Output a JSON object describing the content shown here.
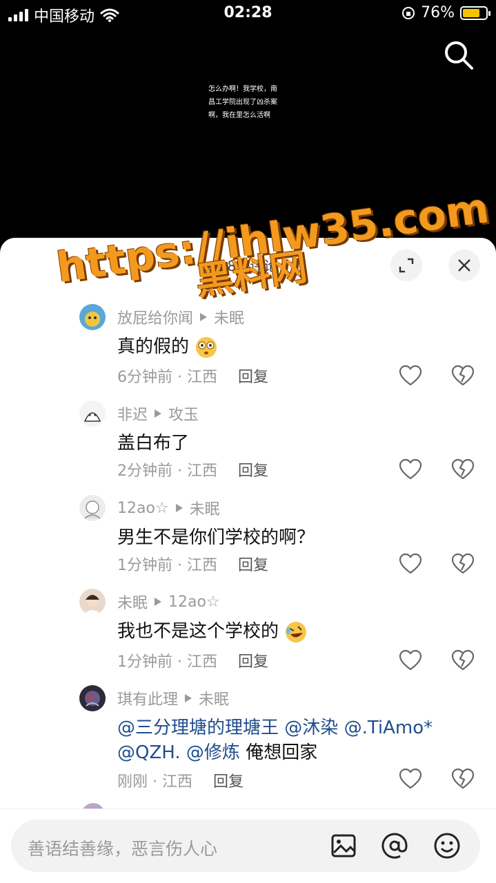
{
  "status_bar": {
    "carrier": "中国移动",
    "time": "02:28",
    "battery_percent": "76%",
    "battery_level": 0.76,
    "battery_color": "#f5c400"
  },
  "video": {
    "overlay_text": [
      "怎么办啊！我学校，南",
      "昌工学院出现了凶杀案",
      "啊，我在里怎么活啊"
    ]
  },
  "watermark": {
    "line1": "https://ihlw35.com",
    "line2": "黑料网"
  },
  "comment_sheet": {
    "count_label": "38条评论",
    "comments": [
      {
        "author": "放屁给你闻",
        "reply_to": "未眠",
        "text": "真的假的",
        "emoji": "flushed-face",
        "time": "6分钟前 · 江西",
        "reply_label": "回复"
      },
      {
        "author": "非迟",
        "reply_to": "攻玉",
        "text": "盖白布了",
        "time": "2分钟前 · 江西",
        "reply_label": "回复"
      },
      {
        "author": "12ao☆",
        "reply_to": "未眠",
        "text": "男生不是你们学校的啊？",
        "time": "1分钟前 · 江西",
        "reply_label": "回复"
      },
      {
        "author": "未眠",
        "reply_to": "12ao☆",
        "text": "我也不是这个学校的",
        "emoji": "rolling-laughing-face",
        "time": "1分钟前 · 江西",
        "reply_label": "回复"
      },
      {
        "author": "琪有此理",
        "reply_to": "未眠",
        "mentions": [
          "@三分理塘的理塘王",
          "@沐染",
          "@.TiAmo*",
          "@QZH.",
          "@修炼"
        ],
        "text": "俺想回家",
        "time": "刚刚 · 江西",
        "reply_label": "回复"
      }
    ]
  },
  "input_bar": {
    "placeholder": "善语结善缘，恶言伤人心"
  },
  "icons": [
    "signal-icon",
    "wifi-icon",
    "orientation-lock-icon",
    "battery-icon",
    "search-icon",
    "expand-icon",
    "close-icon",
    "heart-icon",
    "dislike-icon",
    "image-icon",
    "at-icon",
    "emoji-icon"
  ],
  "colors": {
    "mention": "#1f4e8c",
    "watermark": "#f39a1e"
  }
}
